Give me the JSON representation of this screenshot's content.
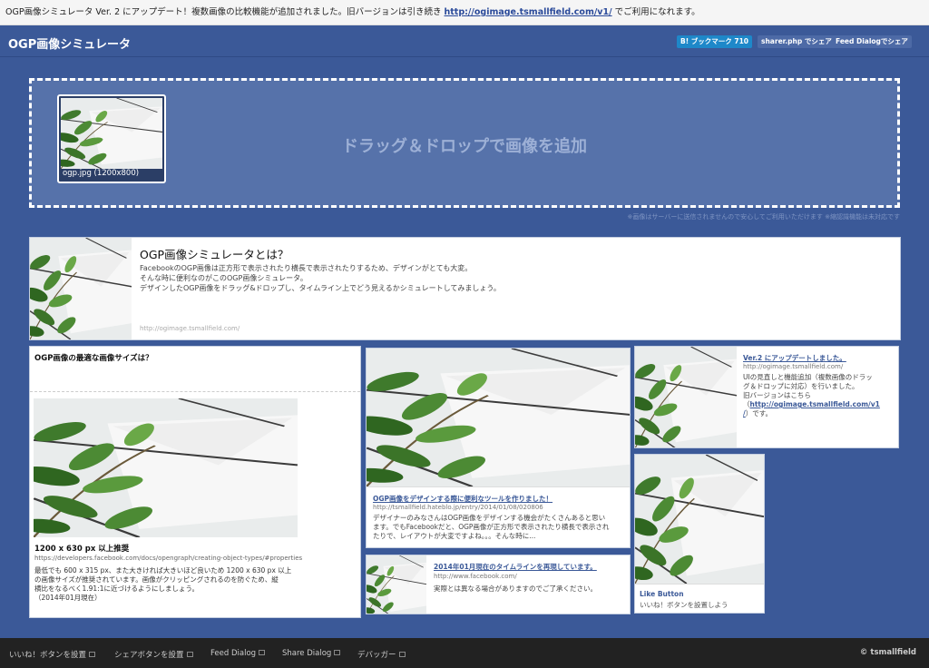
{
  "notice": {
    "text_before": "OGP画像シミュレータ Ver. 2 にアップデート！複数画像の比較機能が追加されました。旧バージョンは引き続き",
    "link": "http://ogimage.tsmallfield.com/v1/",
    "text_after": "でご利用になれます。"
  },
  "header": {
    "title": "OGP画像シミュレータ",
    "hatena_label": "B! ブックマーク",
    "hatena_count": "710",
    "sharer_label": "sharer.php でシェア",
    "feed_label": "Feed Dialogでシェア"
  },
  "dropzone": {
    "label": "ドラッグ＆ドロップで画像を追加",
    "thumb_caption": "ogp.jpg (1200x800)",
    "note": "※画像はサーバーに送信されませんので安心してご利用いただけます ※縮認識機能は未対応です"
  },
  "cards": {
    "intro": {
      "title": "OGP画像シミュレータとは？",
      "lines": [
        "FacebookのOGP画像は正方形で表示されたり横長で表示されたりするため、デザインがとても大変。",
        "そんな時に便利なのがこのOGP画像シミュレータ。",
        "デザインしたOGP画像をドラッグ&ドロップし、タイムライン上でどう見えるかシミュレートしてみましょう。"
      ],
      "url": "http://ogimage.tsmallfield.com/"
    },
    "size": {
      "title": "OGP画像の最適な画像サイズは？",
      "bold": "1200 x 630 px 以上推奨",
      "url": "https://developers.facebook.com/docs/opengraph/creating-object-types/#properties",
      "lines": [
        "最低でも 600 x 315 px、また大きければ大きいほど良いため 1200 x 630 px 以上",
        "の画像サイズが推奨されています。画像がクリッピングされるのを防ぐため、縦",
        "横比をなるべく1.91:1に近づけるようにしましょう。",
        "（2014年01月現在）"
      ]
    },
    "design": {
      "title": "OGP画像をデザインする際に便利なツールを作りました！",
      "url": "http://tsmallfield.hateblo.jp/entry/2014/01/08/020806",
      "lines": [
        "デザイナーのみなさんはOGP画像をデザインする機会がたくさんあると思い",
        "ます。でもFacebookだと、OGP画像が正方形で表示されたり横長で表示され",
        "たりで、レイアウトが大変ですよね。。。そんな時に..."
      ]
    },
    "timeline": {
      "title": "2014年01月現在のタイムラインを再現しています。",
      "url": "http://www.facebook.com/",
      "desc": "実際とは異なる場合がありますのでご了承ください。"
    },
    "version": {
      "title": "Ver.2 にアップデートしました。",
      "url": "http://ogimage.tsmallfield.com/",
      "line1": "UIの見直しと機能追加（複数画像のドラッ",
      "line2": "グ＆ドロップに対応）を行いました。",
      "line3": "旧バージョンはこちら",
      "link_pre": "（",
      "link_a": "http://ogimage.tsmallfield.com/v1",
      "link_b": "/",
      "link_post": "）です。"
    },
    "like": {
      "title": "Like Button",
      "desc": "いいね！ボタンを設置しよう"
    }
  },
  "footer": {
    "links": [
      "いいね！ボタンを設置",
      "シェアボタンを設置",
      "Feed Dialog",
      "Share Dialog",
      "デバッガー"
    ],
    "copyright": "© tsmallfield"
  },
  "colors": {
    "background": "#3b5998",
    "dropzone": "#5672aa",
    "hatena": "#1e88c9",
    "footer": "#222222"
  },
  "icons": [
    "external-link-icon",
    "plant-photo"
  ]
}
